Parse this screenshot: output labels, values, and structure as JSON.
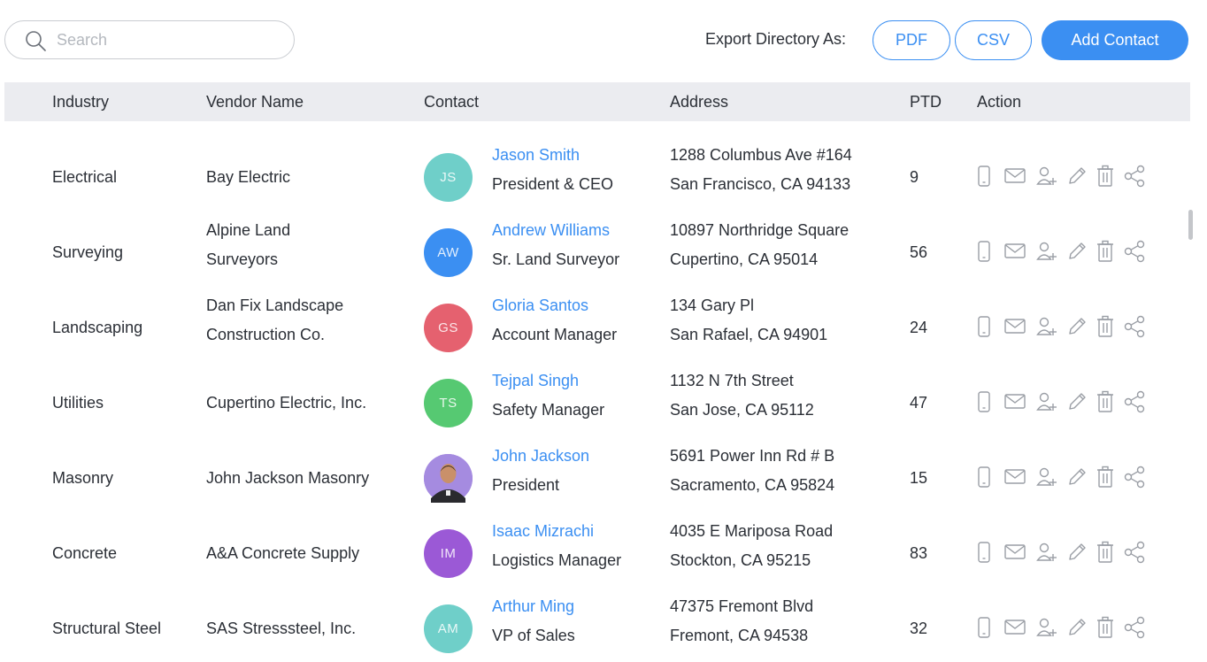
{
  "search": {
    "placeholder": "Search"
  },
  "toolbar": {
    "export_label": "Export Directory As:",
    "pdf_label": "PDF",
    "csv_label": "CSV",
    "add_label": "Add Contact"
  },
  "colors": {
    "accent": "#3b8ff2",
    "header_bg": "#ebecf0",
    "icon_gray": "#9a9ea5"
  },
  "table": {
    "headers": [
      "Industry",
      "Vendor Name",
      "Contact",
      "Address",
      "PTD",
      "Action"
    ],
    "rows": [
      {
        "industry": "Electrical",
        "vendor": [
          "Bay Electric"
        ],
        "initials": "JS",
        "avatar_color": "#6fcfc9",
        "name": "Jason Smith",
        "title": "President & CEO",
        "address1": "1288 Columbus Ave #164",
        "address2": "San Francisco, CA 94133",
        "ptd": "9"
      },
      {
        "industry": "Surveying",
        "vendor": [
          "Alpine Land",
          "Surveyors"
        ],
        "initials": "AW",
        "avatar_color": "#3b8ff2",
        "name": "Andrew Williams",
        "title": "Sr. Land Surveyor",
        "address1": "10897 Northridge Square",
        "address2": "Cupertino, CA 95014",
        "ptd": "56"
      },
      {
        "industry": "Landscaping",
        "vendor": [
          "Dan Fix Landscape",
          "Construction Co."
        ],
        "initials": "GS",
        "avatar_color": "#e5616f",
        "name": "Gloria Santos",
        "title": "Account Manager",
        "address1": "134 Gary Pl",
        "address2": "San Rafael, CA 94901",
        "ptd": "24"
      },
      {
        "industry": "Utilities",
        "vendor": [
          "Cupertino Electric, Inc."
        ],
        "initials": "TS",
        "avatar_color": "#56c972",
        "name": "Tejpal Singh",
        "title": "Safety Manager",
        "address1": "1132 N 7th Street",
        "address2": "San Jose, CA 95112",
        "ptd": "47"
      },
      {
        "industry": "Masonry",
        "vendor": [
          "John Jackson Masonry"
        ],
        "initials": "",
        "avatar_color": "#a58be0",
        "name": "John Jackson",
        "title": "President",
        "address1": "5691 Power Inn Rd # B",
        "address2": "Sacramento, CA 95824",
        "ptd": "15"
      },
      {
        "industry": "Concrete",
        "vendor": [
          "A&A Concrete Supply"
        ],
        "initials": "IM",
        "avatar_color": "#9b59d6",
        "name": "Isaac Mizrachi",
        "title": "Logistics Manager",
        "address1": "4035 E Mariposa Road",
        "address2": "Stockton, CA 95215",
        "ptd": "83"
      },
      {
        "industry": "Structural Steel",
        "vendor": [
          "SAS Stresssteel, Inc."
        ],
        "initials": "AM",
        "avatar_color": "#6fcfc9",
        "name": "Arthur Ming",
        "title": "VP of Sales",
        "address1": "47375 Fremont Blvd",
        "address2": "Fremont, CA 94538",
        "ptd": "32"
      }
    ],
    "action_icons": [
      "phone-icon",
      "mail-icon",
      "add-user-icon",
      "edit-icon",
      "delete-icon",
      "share-icon"
    ]
  }
}
